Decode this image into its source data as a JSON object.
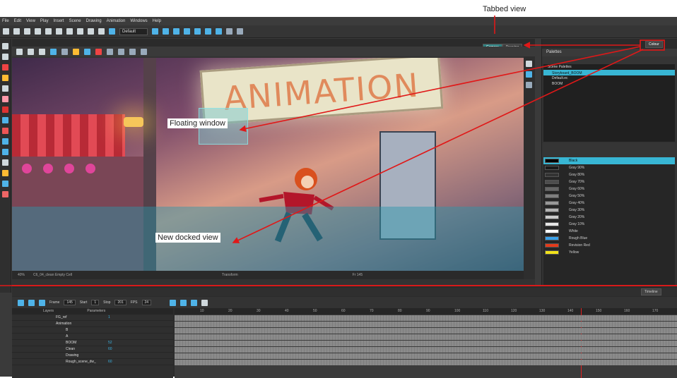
{
  "callouts": {
    "tabbed": "Tabbed view",
    "floating": "Floating window",
    "docked": "New docked view"
  },
  "menu": [
    "File",
    "Edit",
    "View",
    "Play",
    "Insert",
    "Scene",
    "Drawing",
    "Animation",
    "Windows",
    "Help"
  ],
  "toolbar": {
    "workspace_select": "Default"
  },
  "camera": {
    "tabs": [
      "Camera",
      "Drawing"
    ],
    "active_tab": "Camera",
    "sign_text": "ANIMATION",
    "status_zoom": "40%",
    "status_layer": "C6_04_clean Empty Cell",
    "status_mode": "Transform",
    "status_frame": "Fr 145"
  },
  "right_panel": {
    "tab": "Colour",
    "palettes_title": "Palettes",
    "palette_section": "Scene Palettes",
    "palettes": [
      {
        "name": "Storyboard_BOOM",
        "selected": true
      },
      {
        "name": "Default.ec",
        "selected": false
      },
      {
        "name": "BOOM",
        "selected": false
      }
    ],
    "colours": [
      {
        "name": "Black",
        "hex": "#000000",
        "selected": true
      },
      {
        "name": "Gray 90%",
        "hex": "#1a1a1a"
      },
      {
        "name": "Gray 80%",
        "hex": "#333333"
      },
      {
        "name": "Gray 70%",
        "hex": "#4d4d4d"
      },
      {
        "name": "Gray 60%",
        "hex": "#666666"
      },
      {
        "name": "Gray 50%",
        "hex": "#808080"
      },
      {
        "name": "Gray 40%",
        "hex": "#999999"
      },
      {
        "name": "Gray 30%",
        "hex": "#b3b3b3"
      },
      {
        "name": "Gray 20%",
        "hex": "#cccccc"
      },
      {
        "name": "Gray 10%",
        "hex": "#e6e6e6"
      },
      {
        "name": "White",
        "hex": "#ffffff"
      },
      {
        "name": "Rough Blue",
        "hex": "#3aa0e8"
      },
      {
        "name": "Revision Red",
        "hex": "#e43a1a"
      },
      {
        "name": "Yellow",
        "hex": "#f2e21a"
      }
    ]
  },
  "timeline": {
    "tab": "Timeline",
    "frame_label": "Frame",
    "frame_value": "145",
    "start_label": "Start",
    "start_value": "1",
    "stop_label": "Stop",
    "stop_value": "201",
    "fps_label": "FPS",
    "fps_value": "24",
    "layers_header": "Layers",
    "params_header": "Parameters",
    "layers": [
      {
        "name": "FG_ref",
        "value": "1",
        "indent": 1
      },
      {
        "name": "Animation",
        "value": "",
        "indent": 1
      },
      {
        "name": "B",
        "value": "",
        "indent": 2
      },
      {
        "name": "A",
        "value": "",
        "indent": 2
      },
      {
        "name": "BOOM",
        "value": "52",
        "indent": 2
      },
      {
        "name": "Clean",
        "value": "60",
        "indent": 2
      },
      {
        "name": "Drawing",
        "value": "",
        "indent": 2
      },
      {
        "name": "Rough_scene_dw_",
        "value": "60",
        "indent": 2
      }
    ],
    "ruler": [
      "10",
      "20",
      "30",
      "40",
      "50",
      "60",
      "70",
      "80",
      "90",
      "100",
      "110",
      "120",
      "130",
      "140",
      "150",
      "160",
      "170"
    ]
  }
}
